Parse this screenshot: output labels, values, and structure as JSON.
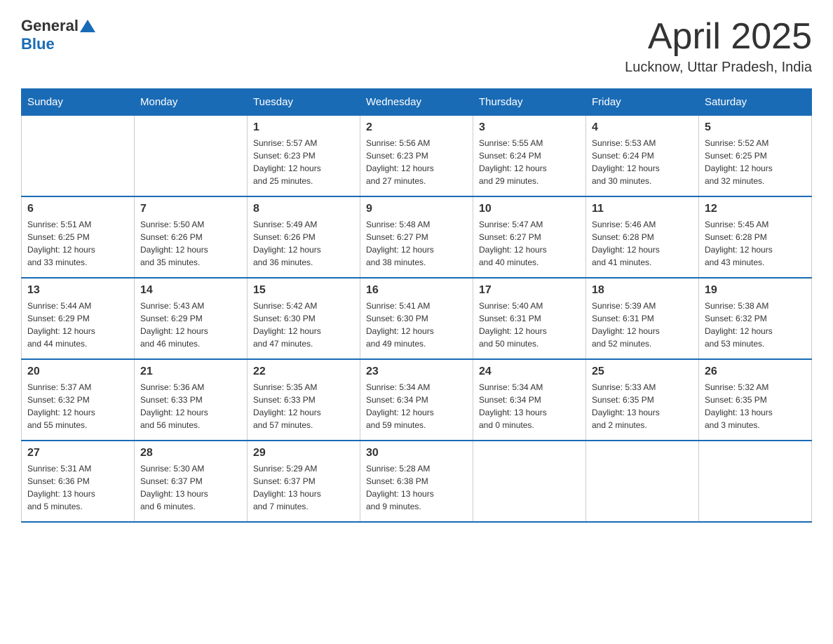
{
  "header": {
    "logo_general": "General",
    "logo_blue": "Blue",
    "month_title": "April 2025",
    "location": "Lucknow, Uttar Pradesh, India"
  },
  "weekdays": [
    "Sunday",
    "Monday",
    "Tuesday",
    "Wednesday",
    "Thursday",
    "Friday",
    "Saturday"
  ],
  "weeks": [
    [
      {
        "day": "",
        "info": ""
      },
      {
        "day": "",
        "info": ""
      },
      {
        "day": "1",
        "info": "Sunrise: 5:57 AM\nSunset: 6:23 PM\nDaylight: 12 hours\nand 25 minutes."
      },
      {
        "day": "2",
        "info": "Sunrise: 5:56 AM\nSunset: 6:23 PM\nDaylight: 12 hours\nand 27 minutes."
      },
      {
        "day": "3",
        "info": "Sunrise: 5:55 AM\nSunset: 6:24 PM\nDaylight: 12 hours\nand 29 minutes."
      },
      {
        "day": "4",
        "info": "Sunrise: 5:53 AM\nSunset: 6:24 PM\nDaylight: 12 hours\nand 30 minutes."
      },
      {
        "day": "5",
        "info": "Sunrise: 5:52 AM\nSunset: 6:25 PM\nDaylight: 12 hours\nand 32 minutes."
      }
    ],
    [
      {
        "day": "6",
        "info": "Sunrise: 5:51 AM\nSunset: 6:25 PM\nDaylight: 12 hours\nand 33 minutes."
      },
      {
        "day": "7",
        "info": "Sunrise: 5:50 AM\nSunset: 6:26 PM\nDaylight: 12 hours\nand 35 minutes."
      },
      {
        "day": "8",
        "info": "Sunrise: 5:49 AM\nSunset: 6:26 PM\nDaylight: 12 hours\nand 36 minutes."
      },
      {
        "day": "9",
        "info": "Sunrise: 5:48 AM\nSunset: 6:27 PM\nDaylight: 12 hours\nand 38 minutes."
      },
      {
        "day": "10",
        "info": "Sunrise: 5:47 AM\nSunset: 6:27 PM\nDaylight: 12 hours\nand 40 minutes."
      },
      {
        "day": "11",
        "info": "Sunrise: 5:46 AM\nSunset: 6:28 PM\nDaylight: 12 hours\nand 41 minutes."
      },
      {
        "day": "12",
        "info": "Sunrise: 5:45 AM\nSunset: 6:28 PM\nDaylight: 12 hours\nand 43 minutes."
      }
    ],
    [
      {
        "day": "13",
        "info": "Sunrise: 5:44 AM\nSunset: 6:29 PM\nDaylight: 12 hours\nand 44 minutes."
      },
      {
        "day": "14",
        "info": "Sunrise: 5:43 AM\nSunset: 6:29 PM\nDaylight: 12 hours\nand 46 minutes."
      },
      {
        "day": "15",
        "info": "Sunrise: 5:42 AM\nSunset: 6:30 PM\nDaylight: 12 hours\nand 47 minutes."
      },
      {
        "day": "16",
        "info": "Sunrise: 5:41 AM\nSunset: 6:30 PM\nDaylight: 12 hours\nand 49 minutes."
      },
      {
        "day": "17",
        "info": "Sunrise: 5:40 AM\nSunset: 6:31 PM\nDaylight: 12 hours\nand 50 minutes."
      },
      {
        "day": "18",
        "info": "Sunrise: 5:39 AM\nSunset: 6:31 PM\nDaylight: 12 hours\nand 52 minutes."
      },
      {
        "day": "19",
        "info": "Sunrise: 5:38 AM\nSunset: 6:32 PM\nDaylight: 12 hours\nand 53 minutes."
      }
    ],
    [
      {
        "day": "20",
        "info": "Sunrise: 5:37 AM\nSunset: 6:32 PM\nDaylight: 12 hours\nand 55 minutes."
      },
      {
        "day": "21",
        "info": "Sunrise: 5:36 AM\nSunset: 6:33 PM\nDaylight: 12 hours\nand 56 minutes."
      },
      {
        "day": "22",
        "info": "Sunrise: 5:35 AM\nSunset: 6:33 PM\nDaylight: 12 hours\nand 57 minutes."
      },
      {
        "day": "23",
        "info": "Sunrise: 5:34 AM\nSunset: 6:34 PM\nDaylight: 12 hours\nand 59 minutes."
      },
      {
        "day": "24",
        "info": "Sunrise: 5:34 AM\nSunset: 6:34 PM\nDaylight: 13 hours\nand 0 minutes."
      },
      {
        "day": "25",
        "info": "Sunrise: 5:33 AM\nSunset: 6:35 PM\nDaylight: 13 hours\nand 2 minutes."
      },
      {
        "day": "26",
        "info": "Sunrise: 5:32 AM\nSunset: 6:35 PM\nDaylight: 13 hours\nand 3 minutes."
      }
    ],
    [
      {
        "day": "27",
        "info": "Sunrise: 5:31 AM\nSunset: 6:36 PM\nDaylight: 13 hours\nand 5 minutes."
      },
      {
        "day": "28",
        "info": "Sunrise: 5:30 AM\nSunset: 6:37 PM\nDaylight: 13 hours\nand 6 minutes."
      },
      {
        "day": "29",
        "info": "Sunrise: 5:29 AM\nSunset: 6:37 PM\nDaylight: 13 hours\nand 7 minutes."
      },
      {
        "day": "30",
        "info": "Sunrise: 5:28 AM\nSunset: 6:38 PM\nDaylight: 13 hours\nand 9 minutes."
      },
      {
        "day": "",
        "info": ""
      },
      {
        "day": "",
        "info": ""
      },
      {
        "day": "",
        "info": ""
      }
    ]
  ]
}
